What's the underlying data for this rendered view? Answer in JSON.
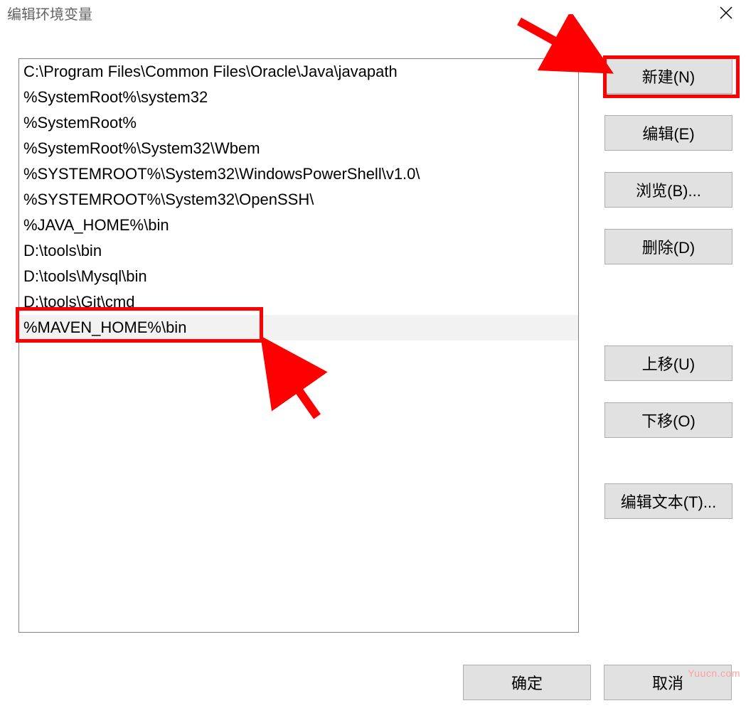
{
  "title": "编辑环境变量",
  "paths": [
    "C:\\Program Files\\Common Files\\Oracle\\Java\\javapath",
    "%SystemRoot%\\system32",
    "%SystemRoot%",
    "%SystemRoot%\\System32\\Wbem",
    "%SYSTEMROOT%\\System32\\WindowsPowerShell\\v1.0\\",
    "%SYSTEMROOT%\\System32\\OpenSSH\\",
    "%JAVA_HOME%\\bin",
    "D:\\tools\\bin",
    "D:\\tools\\Mysql\\bin",
    "D:\\tools\\Git\\cmd",
    "%MAVEN_HOME%\\bin"
  ],
  "selected_index": 10,
  "buttons": {
    "new": "新建(N)",
    "edit": "编辑(E)",
    "browse": "浏览(B)...",
    "delete": "删除(D)",
    "move_up": "上移(U)",
    "move_down": "下移(O)",
    "edit_text": "编辑文本(T)...",
    "ok": "确定",
    "cancel": "取消"
  },
  "watermark": "Yuucn.com"
}
